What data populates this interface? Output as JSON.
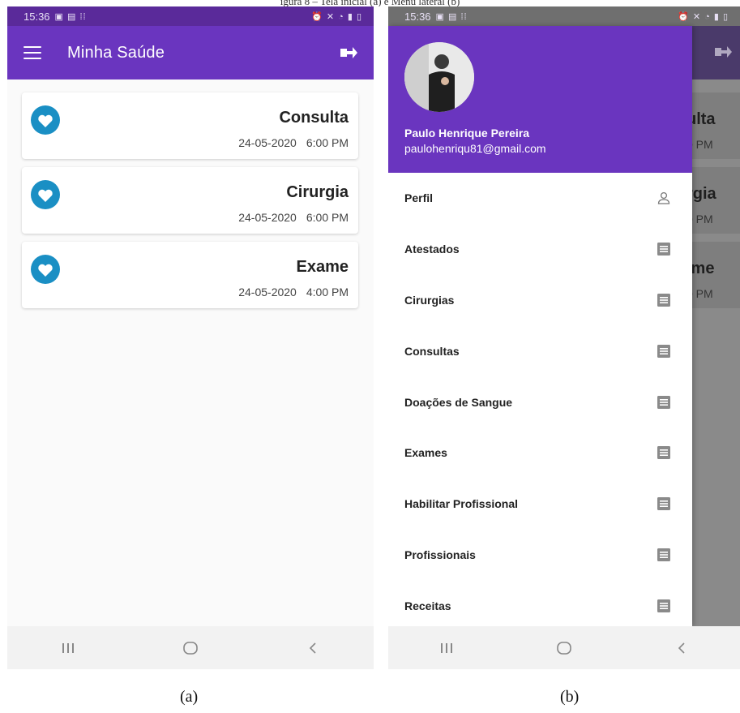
{
  "figure_caption_fragment": "igura 8 – Tela inicial (a) e Menu lateral (b)",
  "colors": {
    "app_bar": "#6a35bf",
    "status_bar": "#5a2a9a",
    "heart_accent": "#1a8fc4"
  },
  "screen_a": {
    "status_time": "15:36",
    "app_title": "Minha Saúde",
    "cards": [
      {
        "type": "Consulta",
        "date": "24-05-2020",
        "time": "6:00 PM",
        "icon": "heart-icon"
      },
      {
        "type": "Cirurgia",
        "date": "24-05-2020",
        "time": "6:00 PM",
        "icon": "heart-icon"
      },
      {
        "type": "Exame",
        "date": "24-05-2020",
        "time": "4:00 PM",
        "icon": "heart-icon"
      }
    ],
    "caption": "(a)"
  },
  "screen_b": {
    "status_time": "15:36",
    "user": {
      "name": "Paulo Henrique Pereira",
      "email": "paulohenriqu81@gmail.com"
    },
    "menu": [
      {
        "label": "Perfil",
        "icon": "person-icon"
      },
      {
        "label": "Atestados",
        "icon": "document-icon"
      },
      {
        "label": "Cirurgias",
        "icon": "document-icon"
      },
      {
        "label": "Consultas",
        "icon": "document-icon"
      },
      {
        "label": "Doações de Sangue",
        "icon": "document-icon"
      },
      {
        "label": "Exames",
        "icon": "document-icon"
      },
      {
        "label": "Habilitar Profissional",
        "icon": "document-icon"
      },
      {
        "label": "Profissionais",
        "icon": "document-icon"
      },
      {
        "label": "Receitas",
        "icon": "document-icon"
      }
    ],
    "background_fragments": [
      {
        "type": "ulta",
        "time": "0 PM"
      },
      {
        "type": "rgia",
        "time": "0 PM"
      },
      {
        "type": "ıme",
        "time": "0 PM"
      }
    ],
    "caption": "(b)"
  }
}
